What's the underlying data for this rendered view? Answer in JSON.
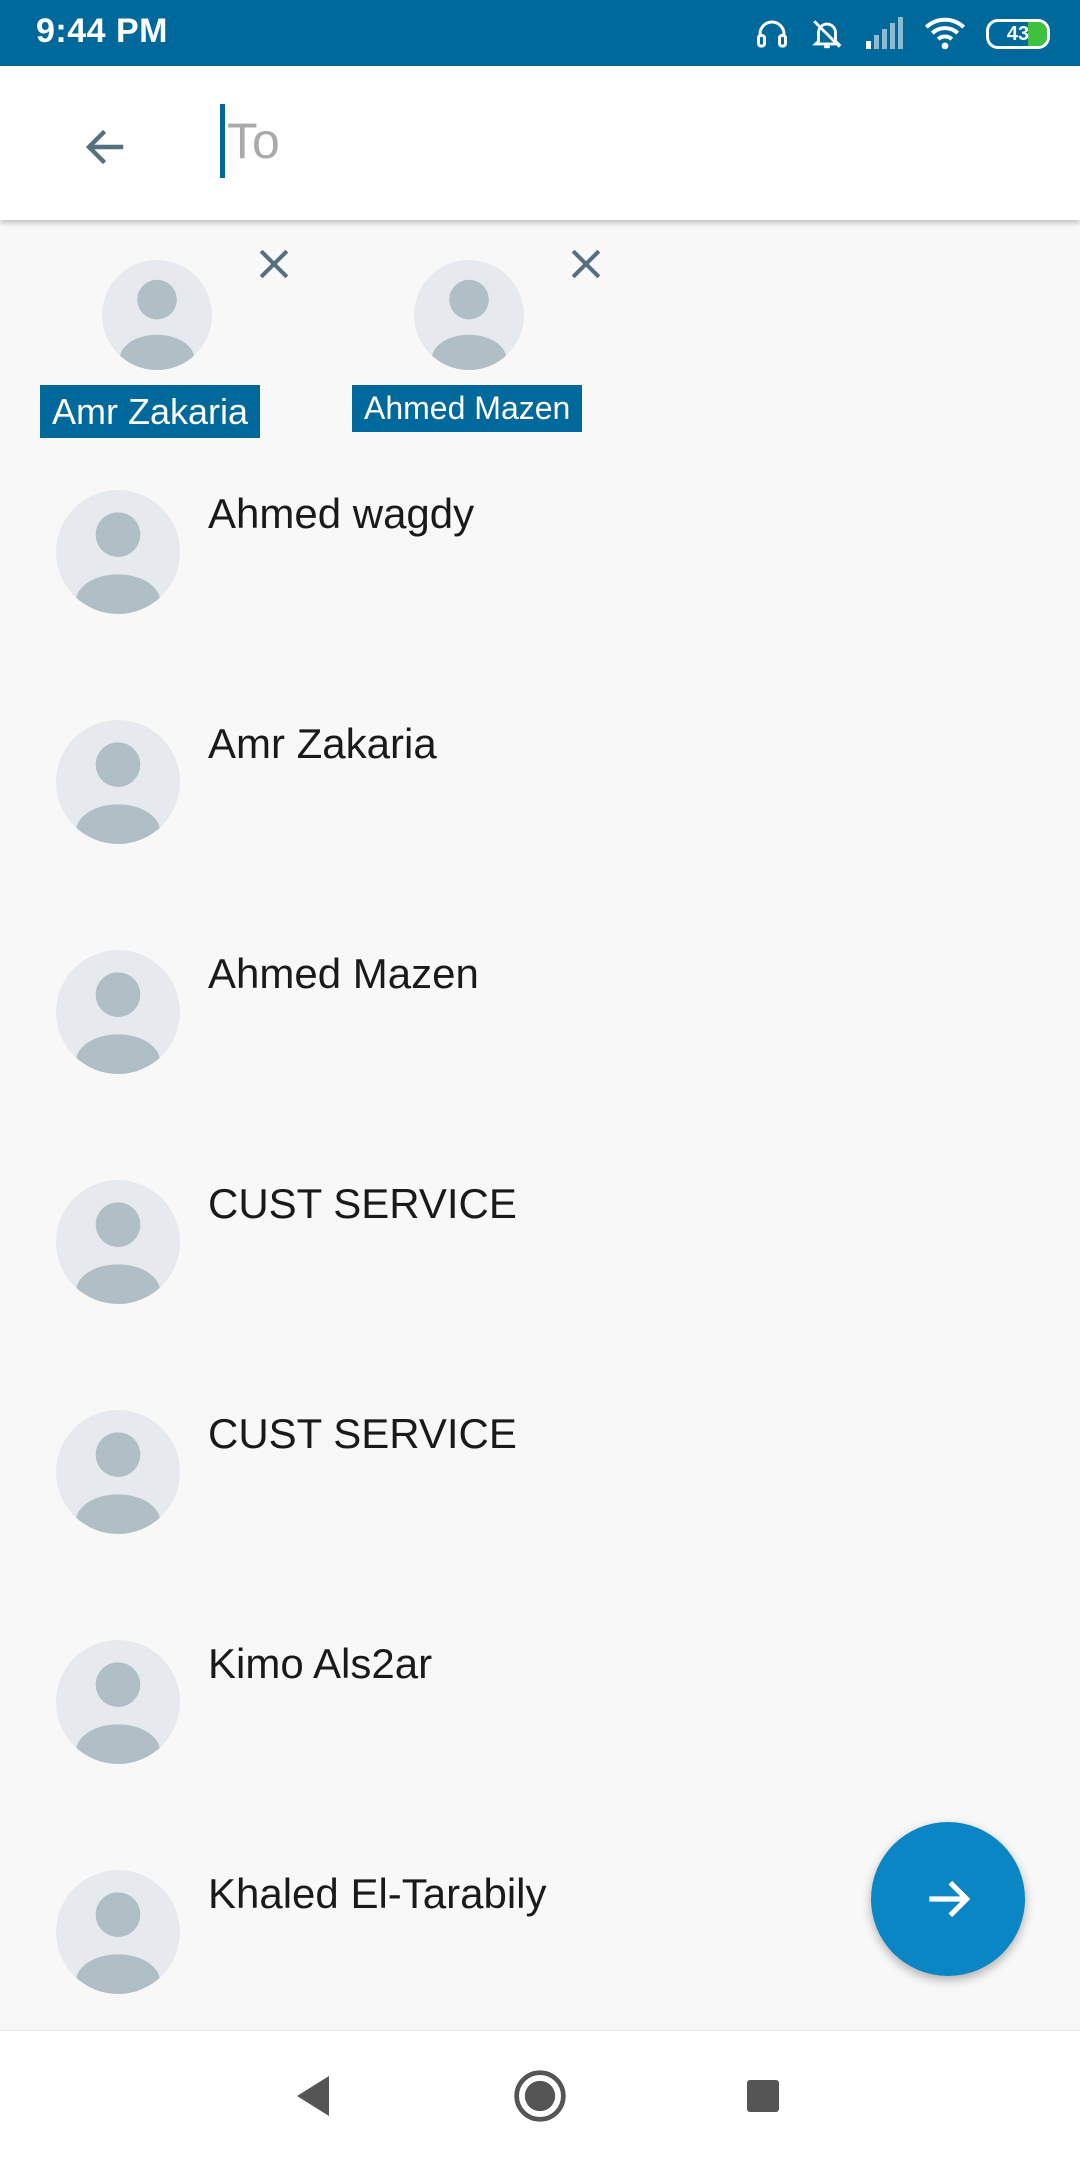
{
  "status_bar": {
    "time": "9:44 PM",
    "battery_level": "43",
    "icons": [
      "headset-icon",
      "bell-off-icon",
      "cell-signal-icon",
      "wifi-icon",
      "battery-icon"
    ]
  },
  "compose": {
    "to_placeholder": "To",
    "to_value": ""
  },
  "selected_recipients": [
    {
      "name": "Amr Zakaria"
    },
    {
      "name": "Ahmed Mazen"
    }
  ],
  "contacts": [
    {
      "name": "Ahmed wagdy"
    },
    {
      "name": "Amr Zakaria"
    },
    {
      "name": "Ahmed Mazen"
    },
    {
      "name": "CUST SERVICE"
    },
    {
      "name": "CUST SERVICE"
    },
    {
      "name": "Kimo Als2ar"
    },
    {
      "name": "Khaled El-Tarabily"
    }
  ],
  "colors": {
    "primary": "#00699b",
    "fab": "#0a86c5",
    "avatar_bg": "#e6eaee",
    "avatar_figure": "#b0bec5"
  }
}
